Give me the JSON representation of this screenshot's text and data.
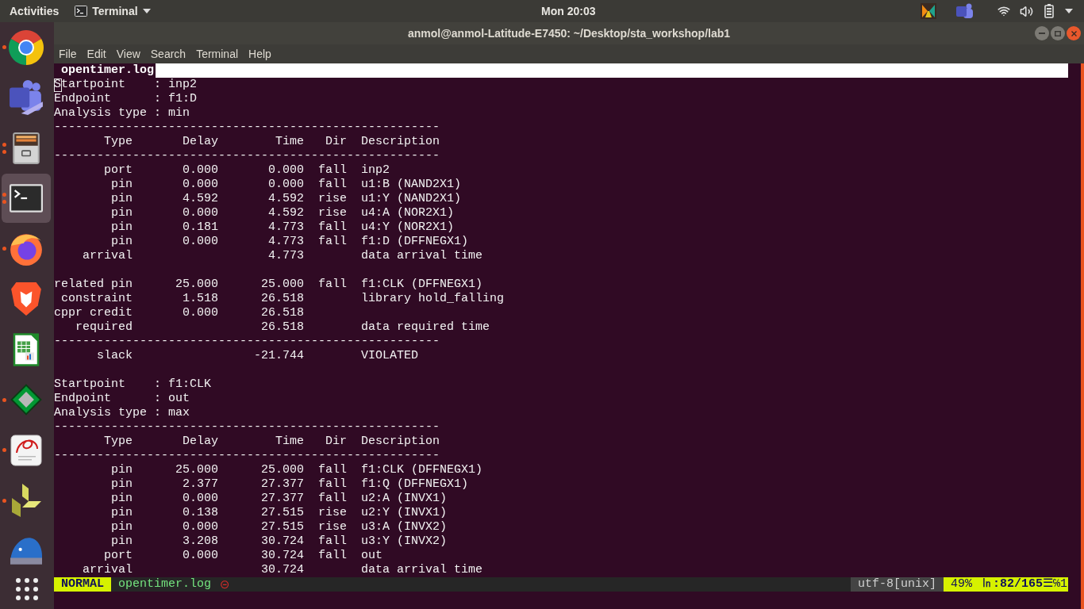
{
  "top_bar": {
    "activities": "Activities",
    "app_menu": "Terminal",
    "clock": "Mon 20:03"
  },
  "dock": {
    "items": [
      {
        "kind": "ring",
        "running": true,
        "second_window": false,
        "selected": false
      },
      {
        "kind": "tile",
        "running": false,
        "second_window": false,
        "selected": false
      },
      {
        "kind": "cabinet",
        "running": true,
        "second_window": true,
        "selected": false
      },
      {
        "kind": "terminal",
        "running": true,
        "second_window": true,
        "selected": true
      },
      {
        "kind": "flame",
        "running": true,
        "second_window": false,
        "selected": false
      },
      {
        "kind": "shield",
        "running": false,
        "second_window": false,
        "selected": false
      },
      {
        "kind": "sheet",
        "running": false,
        "second_window": false,
        "selected": false
      },
      {
        "kind": "diamond",
        "running": true,
        "second_window": false,
        "selected": false
      },
      {
        "kind": "swirl",
        "running": true,
        "second_window": false,
        "selected": false
      },
      {
        "kind": "pinwheel",
        "running": true,
        "second_window": false,
        "selected": false
      },
      {
        "kind": "bird",
        "running": false,
        "second_window": false,
        "selected": false
      }
    ]
  },
  "window": {
    "title": "anmol@anmol-Latitude-E7450: ~/Desktop/sta_workshop/lab1",
    "menu": [
      "File",
      "Edit",
      "View",
      "Search",
      "Terminal",
      "Help"
    ]
  },
  "editor": {
    "tab": {
      "label": "opentimer.log",
      "selected": true
    },
    "cursor_shown": true,
    "lines": [
      {
        "kind": "field",
        "text": "Startpoint    : inp2"
      },
      {
        "kind": "field",
        "text": "Endpoint      : f1:D"
      },
      {
        "kind": "field",
        "text": "Analysis type : min"
      },
      {
        "kind": "rule",
        "text": "------------------------------------------------------"
      },
      {
        "kind": "header",
        "type": "Type",
        "delay": "Delay",
        "time": "Time",
        "dir": "Dir",
        "description": "Description"
      },
      {
        "kind": "rule",
        "text": "------------------------------------------------------"
      },
      {
        "kind": "row",
        "type": "port",
        "delay": "0.000",
        "time": "0.000",
        "dir": "fall",
        "description": "inp2"
      },
      {
        "kind": "row",
        "type": "pin",
        "delay": "0.000",
        "time": "0.000",
        "dir": "fall",
        "description": "u1:B (NAND2X1)"
      },
      {
        "kind": "row",
        "type": "pin",
        "delay": "4.592",
        "time": "4.592",
        "dir": "rise",
        "description": "u1:Y (NAND2X1)"
      },
      {
        "kind": "row",
        "type": "pin",
        "delay": "0.000",
        "time": "4.592",
        "dir": "rise",
        "description": "u4:A (NOR2X1)"
      },
      {
        "kind": "row",
        "type": "pin",
        "delay": "0.181",
        "time": "4.773",
        "dir": "fall",
        "description": "u4:Y (NOR2X1)"
      },
      {
        "kind": "row",
        "type": "pin",
        "delay": "0.000",
        "time": "4.773",
        "dir": "fall",
        "description": "f1:D (DFFNEGX1)"
      },
      {
        "kind": "row",
        "type": "arrival",
        "time": "4.773",
        "description": "data arrival time"
      },
      {
        "kind": "blank"
      },
      {
        "kind": "row",
        "type": "related pin",
        "delay": "25.000",
        "time": "25.000",
        "dir": "fall",
        "description": "f1:CLK (DFFNEGX1)"
      },
      {
        "kind": "row",
        "type": "constraint",
        "delay": "1.518",
        "time": "26.518",
        "description": "library hold_falling"
      },
      {
        "kind": "row",
        "type": "cppr credit",
        "delay": "0.000",
        "time": "26.518"
      },
      {
        "kind": "row",
        "type": "required",
        "time": "26.518",
        "description": "data required time"
      },
      {
        "kind": "rule",
        "text": "------------------------------------------------------"
      },
      {
        "kind": "row",
        "type": "slack",
        "time": "-21.744",
        "description": "VIOLATED"
      },
      {
        "kind": "blank"
      },
      {
        "kind": "field",
        "text": "Startpoint    : f1:CLK"
      },
      {
        "kind": "field",
        "text": "Endpoint      : out"
      },
      {
        "kind": "field",
        "text": "Analysis type : max"
      },
      {
        "kind": "rule",
        "text": "------------------------------------------------------"
      },
      {
        "kind": "header",
        "type": "Type",
        "delay": "Delay",
        "time": "Time",
        "dir": "Dir",
        "description": "Description"
      },
      {
        "kind": "rule",
        "text": "------------------------------------------------------"
      },
      {
        "kind": "row",
        "type": "pin",
        "delay": "25.000",
        "time": "25.000",
        "dir": "fall",
        "description": "f1:CLK (DFFNEGX1)"
      },
      {
        "kind": "row",
        "type": "pin",
        "delay": "2.377",
        "time": "27.377",
        "dir": "fall",
        "description": "f1:Q (DFFNEGX1)"
      },
      {
        "kind": "row",
        "type": "pin",
        "delay": "0.000",
        "time": "27.377",
        "dir": "fall",
        "description": "u2:A (INVX1)"
      },
      {
        "kind": "row",
        "type": "pin",
        "delay": "0.138",
        "time": "27.515",
        "dir": "rise",
        "description": "u2:Y (INVX1)"
      },
      {
        "kind": "row",
        "type": "pin",
        "delay": "0.000",
        "time": "27.515",
        "dir": "rise",
        "description": "u3:A (INVX2)"
      },
      {
        "kind": "row",
        "type": "pin",
        "delay": "3.208",
        "time": "30.724",
        "dir": "fall",
        "description": "u3:Y (INVX2)"
      },
      {
        "kind": "row",
        "type": "port",
        "delay": "0.000",
        "time": "30.724",
        "dir": "fall",
        "description": "out"
      },
      {
        "kind": "row",
        "type": "arrival",
        "time": "30.724",
        "description": "data arrival time"
      }
    ],
    "status_line": {
      "mode": "NORMAL",
      "file": "opentimer.log",
      "readonly_mark": "⊝",
      "encoding": "utf-8[unix]",
      "percent": "49%",
      "position": "**㏑:82/165**☰℅1"
    }
  }
}
